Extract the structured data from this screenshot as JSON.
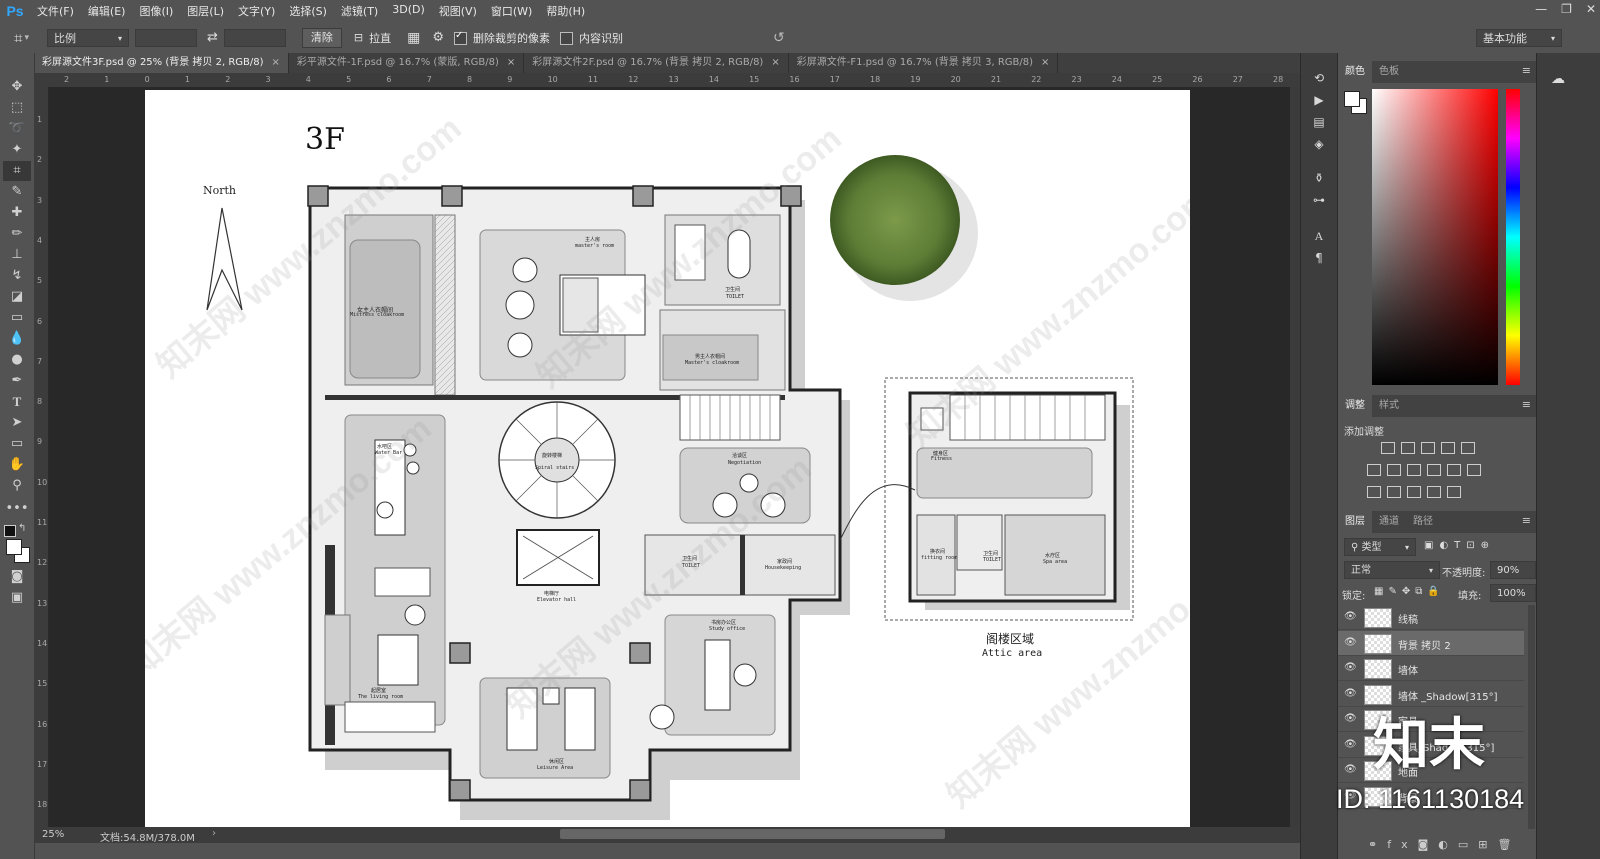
{
  "app": {
    "logo": "Ps"
  },
  "menu": [
    "文件(F)",
    "编辑(E)",
    "图像(I)",
    "图层(L)",
    "文字(Y)",
    "选择(S)",
    "滤镜(T)",
    "3D(D)",
    "视图(V)",
    "窗口(W)",
    "帮助(H)"
  ],
  "window_controls": {
    "minimize": "—",
    "restore": "❐",
    "close": "✕"
  },
  "options": {
    "ratio_select": "比例",
    "swap_icon": "⇄",
    "clear_button": "清除",
    "straighten_label": "拉直",
    "delete_cropped_label": "删除裁剪的像素",
    "delete_cropped_checked": true,
    "content_aware_label": "内容识别",
    "content_aware_checked": false,
    "workspace": "基本功能"
  },
  "tabs": [
    {
      "label": "彩屏源文件3F.psd @ 25% (背景 拷贝 2, RGB/8)",
      "close": "×"
    },
    {
      "label": "彩平源文件-1F.psd @ 16.7% (蒙版, RGB/8)",
      "close": "×"
    },
    {
      "label": "彩屏源文件2F.psd @ 16.7% (背景 拷贝 2, RGB/8)",
      "close": "×"
    },
    {
      "label": "彩屏源文件-F1.psd @ 16.7% (背景 拷贝 3, RGB/8)",
      "close": "×"
    }
  ],
  "ruler_h": [
    "2",
    "1",
    "0",
    "1",
    "2",
    "3",
    "4",
    "5",
    "6",
    "7",
    "8",
    "9",
    "10",
    "11",
    "12",
    "13",
    "14",
    "15",
    "16",
    "17",
    "18",
    "19",
    "20",
    "21",
    "22",
    "23",
    "24",
    "25",
    "26",
    "27",
    "28"
  ],
  "ruler_v": [
    "1",
    "2",
    "3",
    "4",
    "5",
    "6",
    "7",
    "8",
    "9",
    "10",
    "11",
    "12",
    "13",
    "14",
    "15",
    "16",
    "17",
    "18"
  ],
  "status": {
    "zoom": "25%",
    "doc": "文档:54.8M/378.0M"
  },
  "plan": {
    "floor": "3F",
    "north": "North",
    "attic_cn": "阁楼区域",
    "attic_en": "Attic area",
    "rooms": {
      "mistress_cloak": "女主人衣帽间",
      "mistress_cloak_en": "Mistress cloakroom",
      "master_room": "主人房",
      "master_room_en": "master's room",
      "toilet1": "卫生间",
      "toilet1_en": "TOILET",
      "master_cloak": "男主人衣帽间",
      "master_cloak_en": "Master's cloakroom",
      "water_bar": "水吧区",
      "water_bar_en": "Water Bar",
      "spiral": "旋转楼梯",
      "spiral_en": "Spiral stairs",
      "negotiation": "洽谈区",
      "negotiation_en": "Negotiation",
      "toilet2": "卫生间",
      "toilet2_en": "TOILET",
      "housekeeping": "家政间",
      "housekeeping_en": "Housekeeping",
      "elevator": "电梯厅",
      "elevator_en": "Elevator hall",
      "living": "起居室",
      "living_en": "The living room",
      "study": "书房办公区",
      "study_en": "Study office",
      "leisure": "休闲区",
      "leisure_en": "Leisure Area",
      "fitness": "健身区",
      "fitness_en": "Fitness",
      "fitting": "换衣间",
      "fitting_en": "fitting room",
      "toilet3": "卫生间",
      "toilet3_en": "TOILET",
      "spa": "水疗区",
      "spa_en": "Spa area"
    }
  },
  "watermarks": [
    "知末网 www.znzmo.com",
    "知末网 www.znzmo.com",
    "知末网 www.znzmo.com",
    "知末网 www.znzmo.com",
    "知末网 www.znzmo.com",
    "知末网 www.znzmo.com"
  ],
  "brand": {
    "logo": "知末",
    "id": "ID: 1161130184"
  },
  "panels": {
    "color_tabs": [
      "颜色",
      "色板"
    ],
    "adjust_tabs": [
      "调整",
      "样式"
    ],
    "add_adjust": "添加调整",
    "layer_tabs": [
      "图层",
      "通道",
      "路径"
    ],
    "kind": "类型",
    "blend": "正常",
    "opacity_label": "不透明度:",
    "opacity": "90%",
    "lock_label": "锁定:",
    "fill_label": "填充:",
    "fill": "100%",
    "layers": [
      {
        "name": "线稿",
        "selected": false
      },
      {
        "name": "背景 拷贝 2",
        "selected": true
      },
      {
        "name": "墙体",
        "selected": false
      },
      {
        "name": "墙体 _Shadow[315°]",
        "selected": false
      },
      {
        "name": "家具",
        "selected": false
      },
      {
        "name": "家具_Shadow[315°]",
        "selected": false
      },
      {
        "name": "地面",
        "selected": false
      },
      {
        "name": "背景",
        "selected": false
      }
    ]
  },
  "colors": {
    "accent": "#31a8ff",
    "ui_bg": "#535353",
    "panel_dark": "#3d3d3d"
  }
}
